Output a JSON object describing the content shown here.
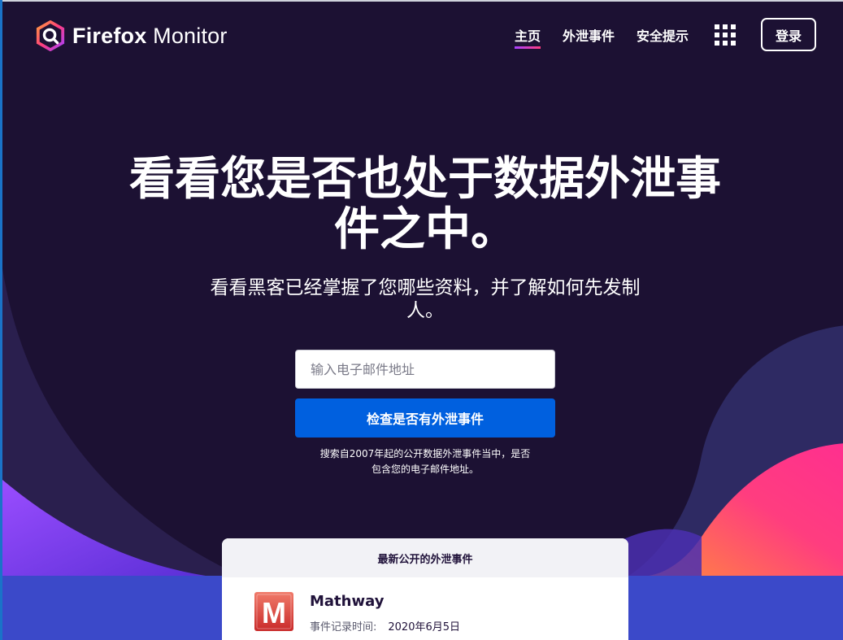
{
  "brand": {
    "name_bold": "Firefox",
    "name_light": "Monitor",
    "logo_icon": "firefox-monitor-logo"
  },
  "nav": {
    "items": [
      {
        "label": "主页",
        "active": true
      },
      {
        "label": "外泄事件",
        "active": false
      },
      {
        "label": "安全提示",
        "active": false
      }
    ],
    "apps_icon": "grid-icon",
    "login_label": "登录"
  },
  "hero": {
    "title_line1": "看看您是否也处于数据外泄事",
    "title_line2": "件之中。",
    "subtitle_line1": "看看黑客已经掌握了您哪些资料，并了解如何先发制",
    "subtitle_line2": "人。",
    "email_placeholder": "输入电子邮件地址",
    "email_value": "",
    "check_button": "检查是否有外泄事件",
    "disclaimer_line1": "搜索自2007年起的公开数据外泄事件当中，是否",
    "disclaimer_line2": "包含您的电子邮件地址。"
  },
  "latest": {
    "heading": "最新公开的外泄事件",
    "breach": {
      "name": "Mathway",
      "date_label": "事件记录时间:",
      "date_value": "2020年6月5日",
      "logo_letter": "M"
    }
  },
  "colors": {
    "background": "#1c1133",
    "primary_button": "#0060df",
    "accent_pink": "#ff3d7f",
    "accent_purple": "#a640ff",
    "band_blue": "#3b49c9"
  }
}
